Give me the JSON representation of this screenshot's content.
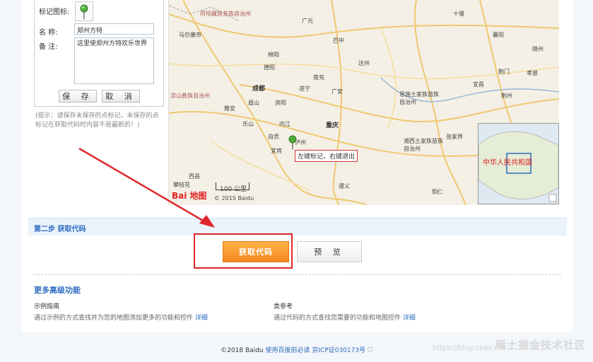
{
  "left_panel": {
    "marker_label": "标记图标:",
    "name_label": "名 称:",
    "name_value": "郑州方特",
    "note_label": "备 注:",
    "note_value": "这里使郑州方特欢乐世界",
    "save_label": "保 存",
    "cancel_label": "取 消",
    "hint": "(提示：请保存未保存的点标记，未保存的点标记在获取代码时内容不是最新的！)"
  },
  "map": {
    "cities": [
      "阿坝藏族羌族自治州",
      "广元",
      "十堰",
      "马尔康市",
      "巴中",
      "襄阳",
      "绵阳",
      "达州",
      "随州",
      "德阳",
      "南充",
      "荆门",
      "成都",
      "遂宁",
      "广安",
      "宜昌",
      "孝感",
      "眉山",
      "资阳",
      "恩施土家族苗族自治州",
      "荆州",
      "雅安",
      "乐山",
      "内江",
      "重庆",
      "凉山彝族自治州",
      "自贡",
      "泸州",
      "宜宾",
      "湘西土家族苗族自治州",
      "张家界",
      "西昌",
      "遵义",
      "铜仁",
      "攀枝花"
    ],
    "tooltip": "左键标记，右键退出",
    "scale": "100 公里",
    "copyright": "© 2015 Baidu",
    "logo": "Bai 地图",
    "inset_label": "中华人民共和国"
  },
  "step2": {
    "title": "第二步 获取代码",
    "get_code_label": "获取代码",
    "preview_label": "预 览"
  },
  "advanced": {
    "title": "更多高级功能",
    "col1_head": "示例指南",
    "col1_desc": "通过示例的方式查找并为您的地图添加更多的功能和控件",
    "col1_link": "详细",
    "col2_head": "类参考",
    "col2_desc": "通过代码的方式查找您需要的功能和地图控件",
    "col2_link": "详细"
  },
  "footer": {
    "copyright": "©2018 Baidu",
    "link1": "使用百度前必读",
    "link2": "京ICP证030173号"
  },
  "watermark": "稀土掘金技术社区",
  "csdn": "https://blog.csdn.net",
  "colors": {
    "accent_blue": "#2d6cc0",
    "orange": "#f5881e",
    "red": "#e0262a"
  }
}
